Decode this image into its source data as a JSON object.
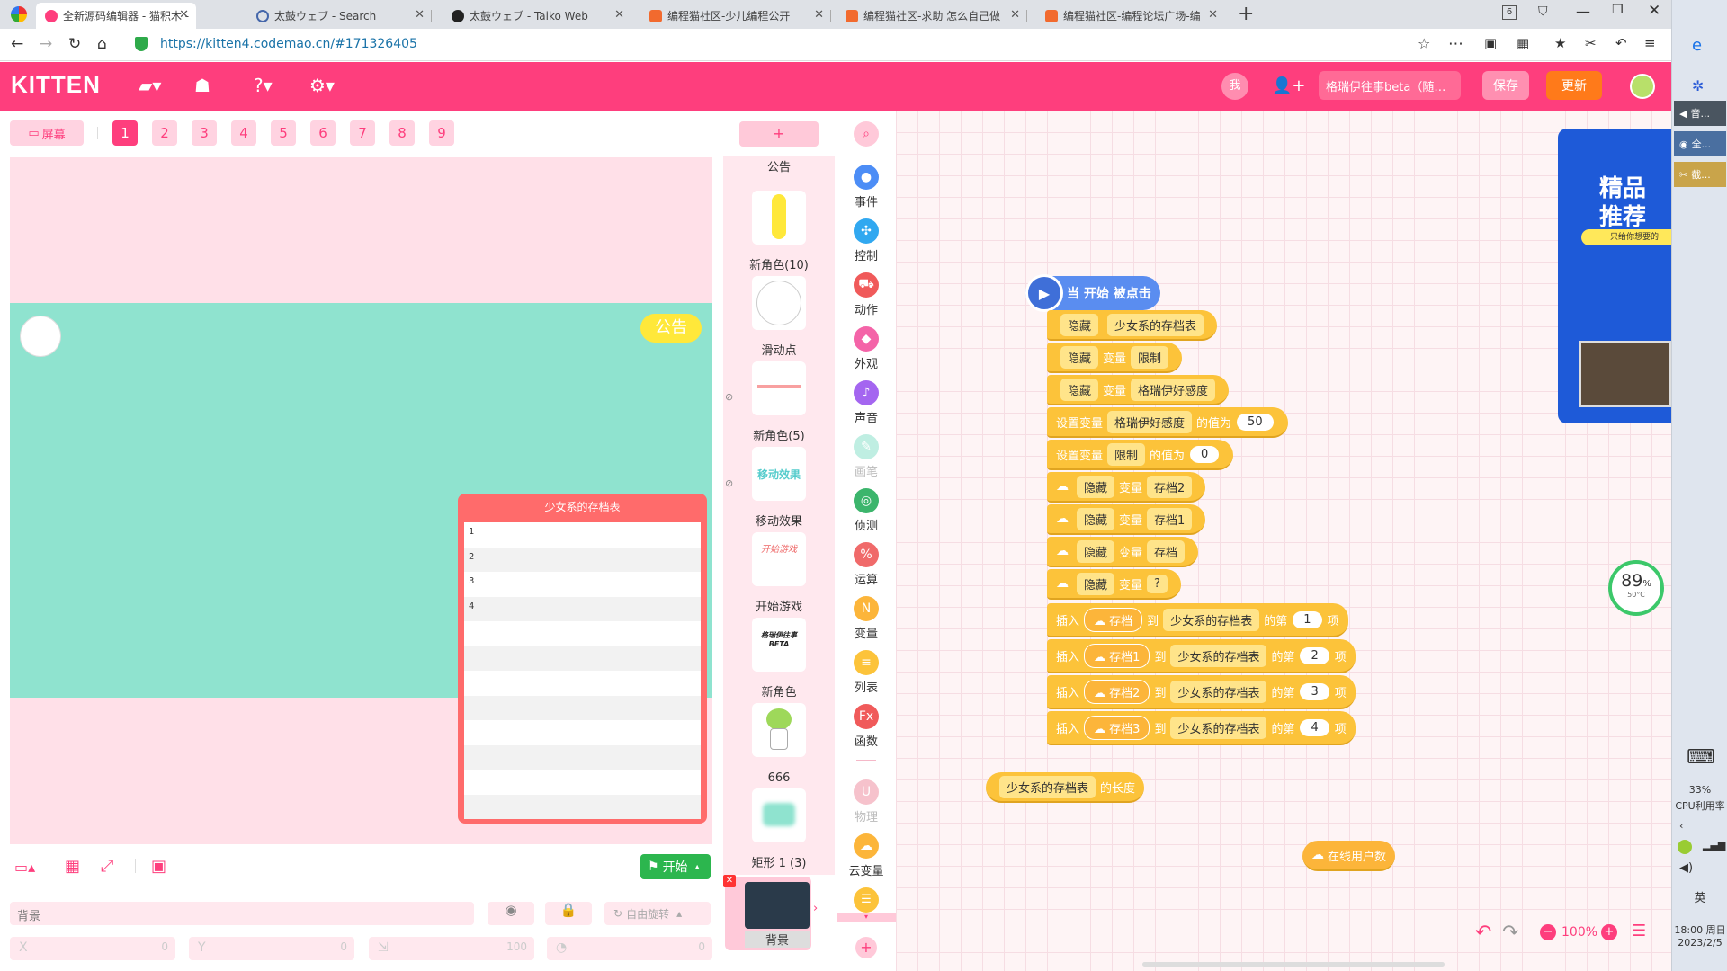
{
  "browser": {
    "tabs": [
      {
        "title": "全新源码编辑器 - 猫积木 -",
        "active": true
      },
      {
        "title": "太鼓ウェブ - Search",
        "active": false
      },
      {
        "title": "太鼓ウェブ - Taiko Web",
        "active": false
      },
      {
        "title": "编程猫社区-少儿编程公开",
        "active": false
      },
      {
        "title": "编程猫社区-求助 怎么自己做",
        "active": false
      },
      {
        "title": "编程猫社区-编程论坛广场-编",
        "active": false
      }
    ],
    "tab_count": "6",
    "url": "https://kitten4.codemao.cn/#171326405"
  },
  "header": {
    "logo": "KITTEN",
    "me": "我",
    "project_name": "格瑞伊往事beta（随…",
    "save": "保存",
    "update": "更新",
    "accent": "#fe3e7d"
  },
  "stage": {
    "screen_btn": "屏幕",
    "scenes": [
      "1",
      "2",
      "3",
      "4",
      "5",
      "6",
      "7",
      "8",
      "9"
    ],
    "notice": "公告",
    "list_title": "少女系的存档表",
    "list_rows": [
      "1",
      "2",
      "3",
      "4",
      "",
      "",
      "",
      "",
      "",
      "",
      "",
      ""
    ],
    "start": "开始",
    "prop_name": "背景",
    "rotate": "自由旋转",
    "x_label": "X",
    "x_val": "0",
    "y_label": "Y",
    "y_val": "0",
    "size_val": "100",
    "dir_val": "0"
  },
  "sprites": {
    "add": "+",
    "top_label": "公告",
    "items": [
      "新角色(10)",
      "滑动点",
      "新角色(5)",
      "移动效果",
      "开始游戏",
      "新角色",
      "666",
      "矩形 1 (3)"
    ],
    "move_fx_text": "移动效果",
    "start_game_text": "开始游戏",
    "gerui_text": "格瑞伊往事 BETA",
    "bg": "背景"
  },
  "categories": [
    {
      "label": "事件",
      "color": "#4c8df6"
    },
    {
      "label": "控制",
      "color": "#31a8f0"
    },
    {
      "label": "动作",
      "color": "#f05a5a"
    },
    {
      "label": "外观",
      "color": "#f464a8"
    },
    {
      "label": "声音",
      "color": "#a466f0"
    },
    {
      "label": "画笔",
      "color": "#7ed6c0"
    },
    {
      "label": "侦测",
      "color": "#3cb56c"
    },
    {
      "label": "运算",
      "color": "#f06a6a"
    },
    {
      "label": "变量",
      "color": "#fcb53a"
    },
    {
      "label": "列表",
      "color": "#fcc33a"
    },
    {
      "label": "函数",
      "color": "#f05a5a"
    },
    {
      "label": "物理",
      "color": "#f2a0b0"
    },
    {
      "label": "云变量",
      "color": "#fcb53a"
    }
  ],
  "script": {
    "hat": "当 开始 被点击",
    "hide": "隐藏",
    "var": "变量",
    "set_var": "设置变量",
    "value_of": "的值为",
    "insert": "插入",
    "to": "到",
    "nth": "的第",
    "item": "项",
    "length": "的长度",
    "list_name": "少女系的存档表",
    "v_limit": "限制",
    "v_gerui": "格瑞伊好感度",
    "n50": "50",
    "n0": "0",
    "s2": "存档2",
    "s1": "存档1",
    "s": "存档",
    "s3": "存档3",
    "q": "?",
    "i1": "1",
    "i2": "2",
    "i3": "3",
    "i4": "4",
    "online": "在线用户数"
  },
  "workspace": {
    "zoom": "100%",
    "ad_title1": "精品",
    "ad_title2": "推荐",
    "ad_sub": "只给你想要的",
    "cpu_gauge": "89",
    "temp": "50°C"
  },
  "taskbar": {
    "items": [
      "音...",
      "全...",
      "截..."
    ],
    "cpu_pct": "33%",
    "cpu_label": "CPU利用率",
    "ime": "英",
    "time": "18:00 周日",
    "date": "2023/2/5"
  }
}
